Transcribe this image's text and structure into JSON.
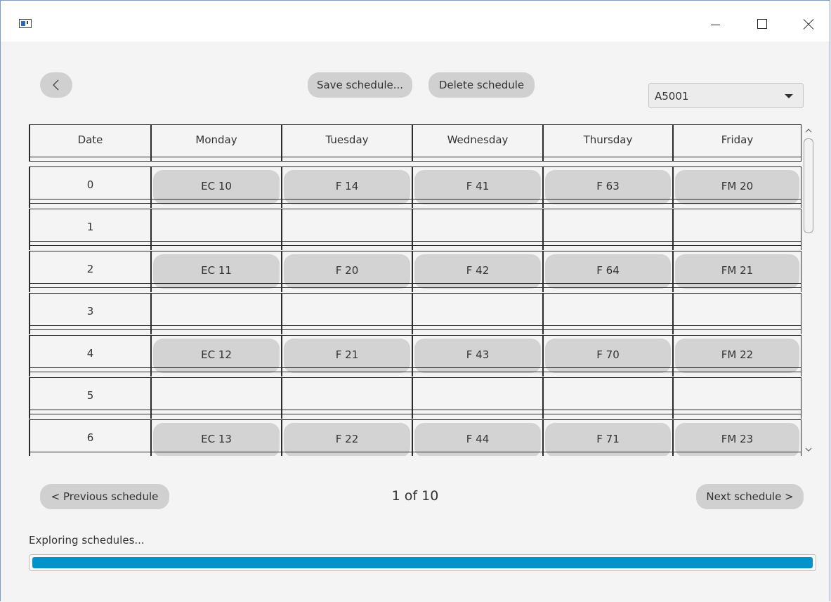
{
  "window": {
    "icon": "app-window-icon"
  },
  "toolbar": {
    "back_icon": "chevron-left-icon",
    "save_label": "Save schedule...",
    "delete_label": "Delete schedule"
  },
  "course_select": {
    "value": "A5001"
  },
  "table": {
    "columns": [
      "Date",
      "Monday",
      "Tuesday",
      "Wednesday",
      "Thursday",
      "Friday"
    ],
    "rows": [
      {
        "date": "0",
        "cells": [
          "EC 10",
          "F 14",
          "F 41",
          "F 63",
          "FM 20"
        ]
      },
      {
        "date": "1",
        "cells": [
          "",
          "",
          "",
          "",
          ""
        ]
      },
      {
        "date": "2",
        "cells": [
          "EC 11",
          "F 20",
          "F 42",
          "F 64",
          "FM 21"
        ]
      },
      {
        "date": "3",
        "cells": [
          "",
          "",
          "",
          "",
          ""
        ]
      },
      {
        "date": "4",
        "cells": [
          "EC 12",
          "F 21",
          "F 43",
          "F 70",
          "FM 22"
        ]
      },
      {
        "date": "5",
        "cells": [
          "",
          "",
          "",
          "",
          ""
        ]
      },
      {
        "date": "6",
        "cells": [
          "EC 13",
          "F 22",
          "F 44",
          "F 71",
          "FM 23"
        ]
      }
    ]
  },
  "pagination": {
    "prev_label": "< Previous schedule",
    "indicator": "1 of 10",
    "next_label": "Next schedule >"
  },
  "status": {
    "text": "Exploring schedules...",
    "progress": 1.0,
    "progress_color": "#0493c8"
  },
  "colors": {
    "pill": "#d0d0d0",
    "background": "#f4f4f4"
  }
}
